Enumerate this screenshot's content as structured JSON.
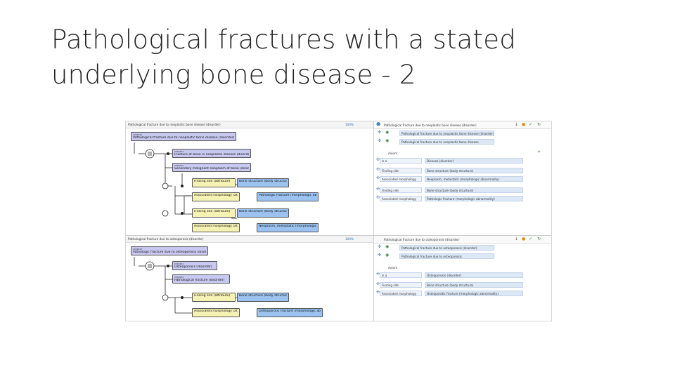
{
  "title": {
    "line1": "Pathological fractures with a stated",
    "line2": "underlying bone disease - 2"
  },
  "screenshot": {
    "top_view": {
      "header": "Pathological fracture due to neoplastic bone disease (disorder)",
      "zoom": "100%",
      "root": {
        "id": "xxxxxxx",
        "label": "Pathological fracture due to neoplastic bone disease (disorder)"
      },
      "parents": [
        {
          "id": "xxxxxxx",
          "label": "Fracture of bone in neoplastic disease (disorder)"
        },
        {
          "id": "xxxxxxx",
          "label": "Secondary malignant neoplasm of bone (disorder)"
        }
      ],
      "groups": [
        [
          {
            "attr": "Finding site (attribute)",
            "value": "Bone structure (body structure)"
          },
          {
            "attr": "Associated morphology (attribute)",
            "value": "Pathologic fracture (morphologic abnormality)"
          }
        ],
        [
          {
            "attr": "Finding site (attribute)",
            "value": "Bone structure (body structure)"
          },
          {
            "attr": "Associated morphology (attribute)",
            "value": "Neoplasm, metastatic (morphologic abnormality)"
          }
        ]
      ]
    },
    "bottom_view": {
      "header": "Pathological fracture due to osteoporosis (disorder)",
      "zoom": "100%",
      "root": {
        "id": "xxxxxxx",
        "label": "Pathologic fracture due to osteoporosis (disorder)"
      },
      "parents": [
        {
          "id": "xxxxxxx",
          "label": "Osteoporosis (disorder)"
        },
        {
          "id": "xxxxxxx",
          "label": "Pathological fracture (disorder)"
        }
      ],
      "groups": [
        [
          {
            "attr": "Finding site (attribute)",
            "value": "Bone structure (body structure)"
          },
          {
            "attr": "Associated morphology (attribute)",
            "value": "Osteoporotic fracture (morphologic abnormality)"
          }
        ]
      ]
    },
    "top_panel": {
      "concept": "Pathological fracture due to neoplastic bone disease (disorder)",
      "descriptions": [
        "Pathological fracture due to neoplastic bone disease (disorder)",
        "Pathological fracture due to neoplastic bone disease"
      ],
      "axiom_label": "Axiom",
      "rows": [
        {
          "attr": "Is a",
          "value": "Disease (disorder)"
        },
        {
          "attr": "Finding site",
          "value": "Bone structure (body structure)"
        },
        {
          "attr": "Associated morphology",
          "value": "Neoplasm, metastatic (morphologic abnormality)"
        },
        {
          "attr": "Finding site",
          "value": "Bone structure (body structure)"
        },
        {
          "attr": "Associated morphology",
          "value": "Pathologic fracture (morphologic abnormality)"
        }
      ]
    },
    "bottom_panel": {
      "concept": "Pathological fracture due to osteoporosis (disorder)",
      "descriptions": [
        "Pathological fracture due to osteoporosis (disorder)",
        "Pathological fracture due to osteoporosis"
      ],
      "axiom_label": "Axiom",
      "rows": [
        {
          "attr": "Is a",
          "value": "Osteoporosis (disorder)"
        },
        {
          "attr": "Finding site",
          "value": "Bone structure (body structure)"
        },
        {
          "attr": "Associated morphology",
          "value": "Osteoporotic fracture (morphologic abnormality)"
        }
      ]
    }
  }
}
